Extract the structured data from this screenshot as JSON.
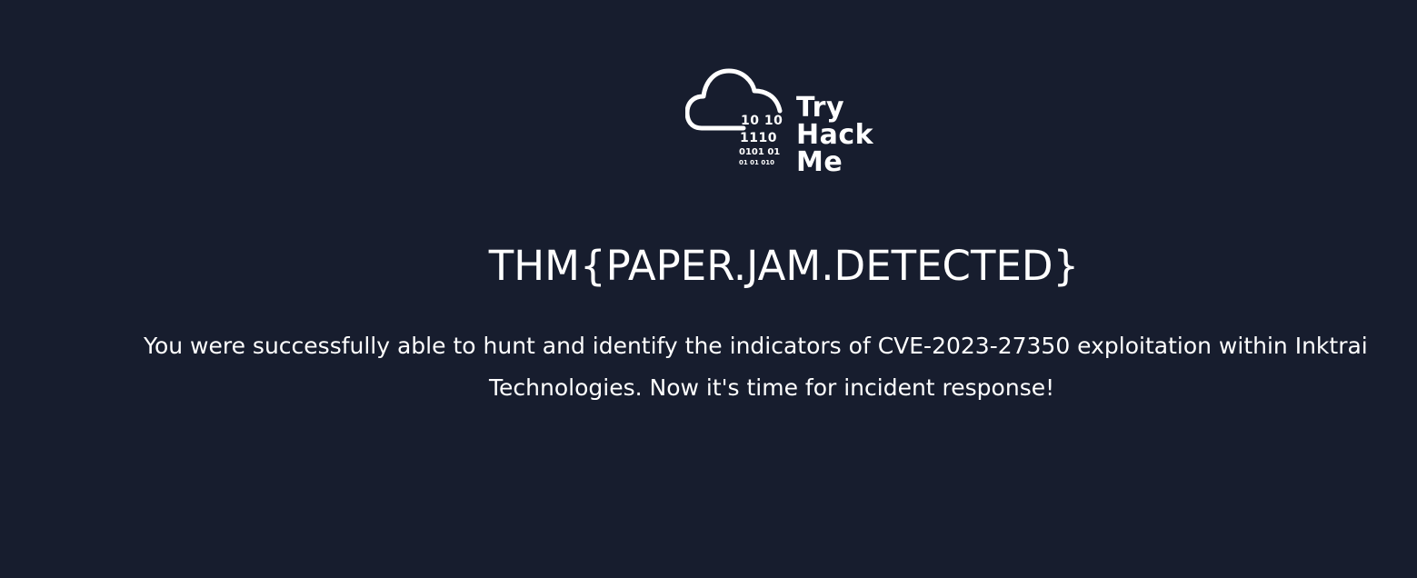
{
  "logo": {
    "icon": "cloud-icon",
    "binary_lines": [
      "10 10",
      "1110",
      "0101 01",
      "01  01 010"
    ],
    "brand_lines": [
      "Try",
      "Hack",
      "Me"
    ]
  },
  "main": {
    "flag": "THM{PAPER.JAM.DETECTED}",
    "message_line1": "You were successfully able to hunt and identify the indicators of CVE-2023-27350 exploitation within Inktrai",
    "message_line2": "Technologies. Now it's time for incident response!"
  },
  "colors": {
    "background": "#171d2e",
    "text": "#ffffff"
  }
}
